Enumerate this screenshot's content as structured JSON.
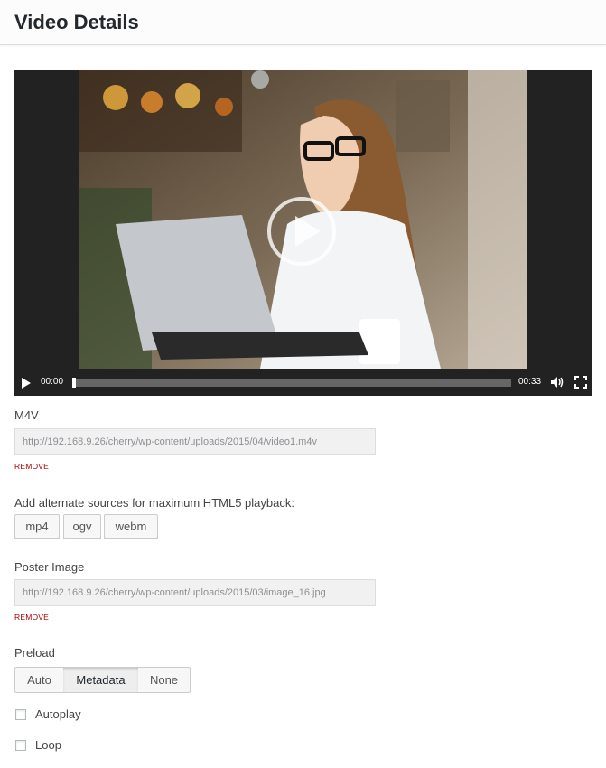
{
  "header": {
    "title": "Video Details"
  },
  "player": {
    "current_time": "00:00",
    "duration": "00:33",
    "progress": 0
  },
  "m4v": {
    "label": "M4V",
    "url": "http://192.168.9.26/cherry/wp-content/uploads/2015/04/video1.m4v",
    "remove": "REMOVE"
  },
  "alternate": {
    "label": "Add alternate sources for maximum HTML5 playback:",
    "buttons": [
      "mp4",
      "ogv",
      "webm"
    ]
  },
  "poster": {
    "label": "Poster Image",
    "url": "http://192.168.9.26/cherry/wp-content/uploads/2015/03/image_16.jpg",
    "remove": "REMOVE"
  },
  "preload": {
    "label": "Preload",
    "options": [
      "Auto",
      "Metadata",
      "None"
    ],
    "selected": "Metadata"
  },
  "options": {
    "autoplay": {
      "label": "Autoplay",
      "checked": false
    },
    "loop": {
      "label": "Loop",
      "checked": false
    }
  },
  "colors": {
    "remove_link": "#aa0000",
    "player_bg": "#222222"
  }
}
